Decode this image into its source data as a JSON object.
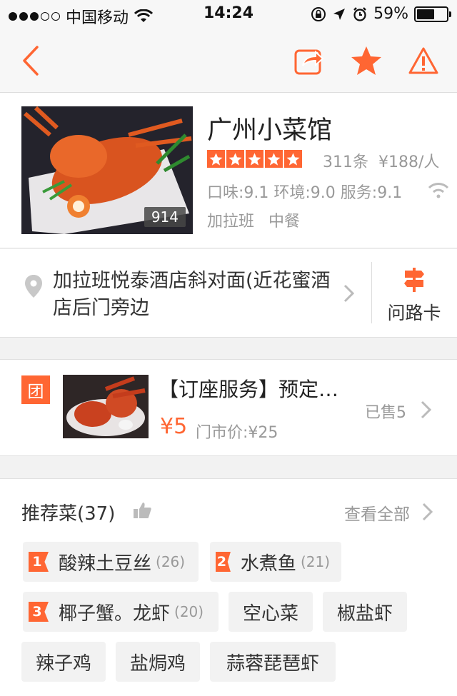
{
  "status": {
    "carrier": "中国移动",
    "time": "14:24",
    "battery": "59%",
    "battery_level": 0.59
  },
  "nav": {
    "back_icon": "back-arrow-icon",
    "share_icon": "share-icon",
    "favorite_icon": "star-icon",
    "report_icon": "warning-icon"
  },
  "shop": {
    "name": "广州小菜馆",
    "photo_count": "914",
    "rating_stars": 5,
    "reviews": "311条",
    "avg_price": "¥188/人",
    "scores": "口味:9.1 环境:9.0 服务:9.1",
    "tags": [
      "加拉班",
      "中餐"
    ]
  },
  "address": {
    "text": "加拉班悦泰酒店斜对面(近花蜜酒店后门旁边",
    "route_card_label": "问路卡"
  },
  "deal": {
    "badge": "团",
    "title": "【订座服务】预定…",
    "price": "¥5",
    "original_price": "门市价:¥25",
    "sold": "已售5"
  },
  "dishes": {
    "title": "推荐菜(37)",
    "view_all": "查看全部",
    "items": [
      {
        "rank": "1",
        "name": "酸辣土豆丝",
        "count": "(26)"
      },
      {
        "rank": "2",
        "name": "水煮鱼",
        "count": "(21)"
      },
      {
        "rank": "3",
        "name": "椰子蟹。龙虾",
        "count": "(20)"
      },
      {
        "name": "空心菜"
      },
      {
        "name": "椒盐虾"
      },
      {
        "name": "辣子鸡"
      },
      {
        "name": "盐焗鸡"
      },
      {
        "name": "蒜蓉琵琶虾"
      }
    ]
  },
  "colors": {
    "accent": "#ff6633",
    "muted": "#999999"
  }
}
